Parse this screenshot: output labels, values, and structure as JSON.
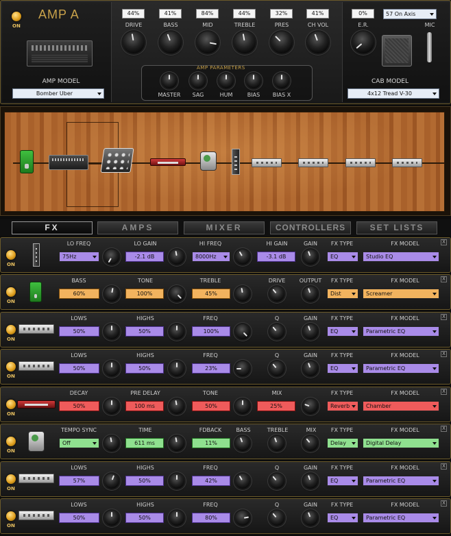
{
  "amp": {
    "on_label": "ON",
    "title": "AMP A",
    "model_label": "AMP MODEL",
    "model_value": "Bomber Uber",
    "controls": [
      {
        "label": "DRIVE",
        "value": "44%"
      },
      {
        "label": "BASS",
        "value": "41%"
      },
      {
        "label": "MID",
        "value": "84%"
      },
      {
        "label": "TREBLE",
        "value": "44%"
      },
      {
        "label": "PRES",
        "value": "32%"
      },
      {
        "label": "CH VOL",
        "value": "41%"
      }
    ],
    "params_title": "AMP PARAMETERS",
    "params": [
      "MASTER",
      "SAG",
      "HUM",
      "BIAS",
      "BIAS X"
    ]
  },
  "cab": {
    "er_label": "E.R.",
    "er_value": "0%",
    "mic_position": "57 On Axis",
    "mic_label": "MIC",
    "model_label": "CAB MODEL",
    "model_value": "4x12 Tread V-30"
  },
  "tabs": [
    "FX",
    "AMPS",
    "MIXER",
    "CONTROLLERS",
    "SET LISTS"
  ],
  "active_tab": "FX",
  "fx_type_label": "FX TYPE",
  "fx_model_label": "FX MODEL",
  "close_label": "X",
  "rows": [
    {
      "on": "ON",
      "params": [
        {
          "label": "LO FREQ",
          "value": "75Hz"
        },
        {
          "label": "LO GAIN",
          "value": "-2.1 dB"
        },
        {
          "label": "HI FREQ",
          "value": "8000Hz"
        },
        {
          "label": "HI GAIN",
          "value": "-3.1 dB"
        },
        {
          "label": "GAIN",
          "value": ""
        }
      ],
      "type": "EQ",
      "model": "Studio EQ",
      "color": "purple"
    },
    {
      "on": "ON",
      "params": [
        {
          "label": "BASS",
          "value": "60%"
        },
        {
          "label": "TONE",
          "value": "100%"
        },
        {
          "label": "TREBLE",
          "value": "45%"
        },
        {
          "label": "DRIVE",
          "value": ""
        },
        {
          "label": "OUTPUT",
          "value": ""
        }
      ],
      "type": "Dist",
      "model": "Screamer",
      "color": "orange"
    },
    {
      "on": "ON",
      "params": [
        {
          "label": "LOWS",
          "value": "50%"
        },
        {
          "label": "HIGHS",
          "value": "50%"
        },
        {
          "label": "FREQ",
          "value": "100%"
        },
        {
          "label": "Q",
          "value": ""
        },
        {
          "label": "GAIN",
          "value": ""
        }
      ],
      "type": "EQ",
      "model": "Parametric EQ",
      "color": "purple"
    },
    {
      "on": "ON",
      "params": [
        {
          "label": "LOWS",
          "value": "50%"
        },
        {
          "label": "HIGHS",
          "value": "50%"
        },
        {
          "label": "FREQ",
          "value": "23%"
        },
        {
          "label": "Q",
          "value": ""
        },
        {
          "label": "GAIN",
          "value": ""
        }
      ],
      "type": "EQ",
      "model": "Parametric EQ",
      "color": "purple"
    },
    {
      "on": "ON",
      "params": [
        {
          "label": "DECAY",
          "value": "50%"
        },
        {
          "label": "PRE DELAY",
          "value": "100 ms"
        },
        {
          "label": "TONE",
          "value": "50%"
        },
        {
          "label": "MIX",
          "value": "25%"
        },
        {
          "label": "",
          "value": ""
        }
      ],
      "type": "Reverb",
      "model": "Chamber",
      "color": "red"
    },
    {
      "on": "ON",
      "params": [
        {
          "label": "TEMPO SYNC",
          "value": "Off"
        },
        {
          "label": "TIME",
          "value": "611 ms"
        },
        {
          "label": "FDBACK",
          "value": "11%"
        },
        {
          "label": "BASS",
          "value": ""
        },
        {
          "label": "TREBLE",
          "value": ""
        },
        {
          "label": "MIX",
          "value": ""
        }
      ],
      "type": "Delay",
      "model": "Digital Delay",
      "color": "green"
    },
    {
      "on": "ON",
      "params": [
        {
          "label": "LOWS",
          "value": "57%"
        },
        {
          "label": "HIGHS",
          "value": "50%"
        },
        {
          "label": "FREQ",
          "value": "42%"
        },
        {
          "label": "Q",
          "value": ""
        },
        {
          "label": "GAIN",
          "value": ""
        }
      ],
      "type": "EQ",
      "model": "Parametric EQ",
      "color": "purple"
    },
    {
      "on": "ON",
      "params": [
        {
          "label": "LOWS",
          "value": "50%"
        },
        {
          "label": "HIGHS",
          "value": "50%"
        },
        {
          "label": "FREQ",
          "value": "80%"
        },
        {
          "label": "Q",
          "value": ""
        },
        {
          "label": "GAIN",
          "value": ""
        }
      ],
      "type": "EQ",
      "model": "Parametric EQ",
      "color": "purple"
    }
  ]
}
